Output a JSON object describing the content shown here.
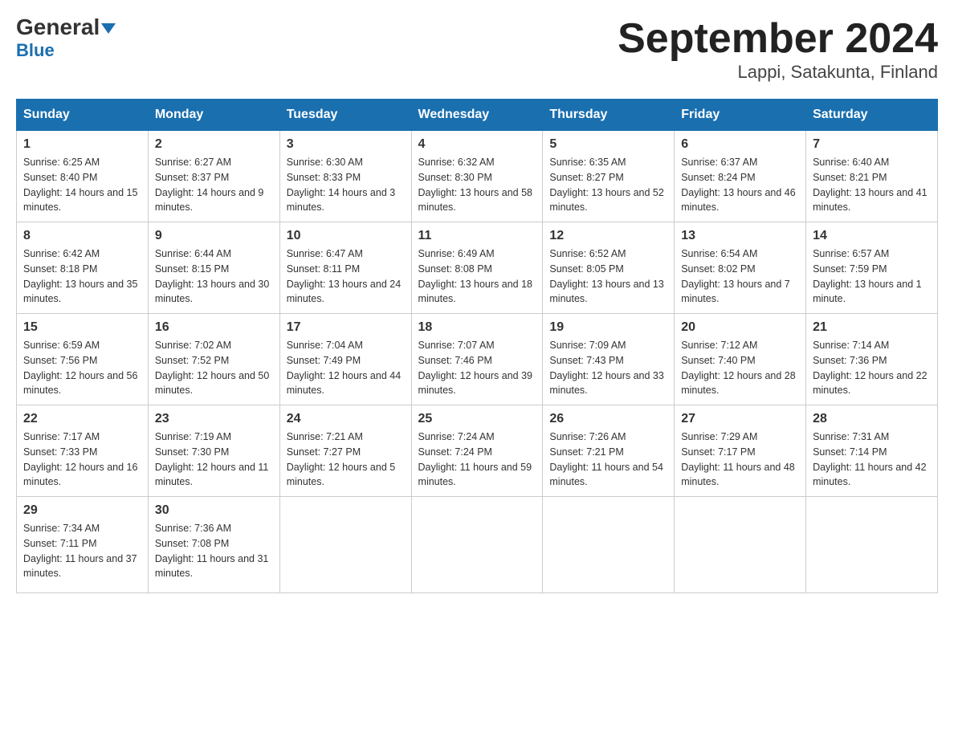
{
  "header": {
    "logo_general": "General",
    "logo_blue": "Blue",
    "month_title": "September 2024",
    "subtitle": "Lappi, Satakunta, Finland"
  },
  "calendar": {
    "days_of_week": [
      "Sunday",
      "Monday",
      "Tuesday",
      "Wednesday",
      "Thursday",
      "Friday",
      "Saturday"
    ],
    "weeks": [
      [
        {
          "day": "1",
          "sunrise": "6:25 AM",
          "sunset": "8:40 PM",
          "daylight": "14 hours and 15 minutes."
        },
        {
          "day": "2",
          "sunrise": "6:27 AM",
          "sunset": "8:37 PM",
          "daylight": "14 hours and 9 minutes."
        },
        {
          "day": "3",
          "sunrise": "6:30 AM",
          "sunset": "8:33 PM",
          "daylight": "14 hours and 3 minutes."
        },
        {
          "day": "4",
          "sunrise": "6:32 AM",
          "sunset": "8:30 PM",
          "daylight": "13 hours and 58 minutes."
        },
        {
          "day": "5",
          "sunrise": "6:35 AM",
          "sunset": "8:27 PM",
          "daylight": "13 hours and 52 minutes."
        },
        {
          "day": "6",
          "sunrise": "6:37 AM",
          "sunset": "8:24 PM",
          "daylight": "13 hours and 46 minutes."
        },
        {
          "day": "7",
          "sunrise": "6:40 AM",
          "sunset": "8:21 PM",
          "daylight": "13 hours and 41 minutes."
        }
      ],
      [
        {
          "day": "8",
          "sunrise": "6:42 AM",
          "sunset": "8:18 PM",
          "daylight": "13 hours and 35 minutes."
        },
        {
          "day": "9",
          "sunrise": "6:44 AM",
          "sunset": "8:15 PM",
          "daylight": "13 hours and 30 minutes."
        },
        {
          "day": "10",
          "sunrise": "6:47 AM",
          "sunset": "8:11 PM",
          "daylight": "13 hours and 24 minutes."
        },
        {
          "day": "11",
          "sunrise": "6:49 AM",
          "sunset": "8:08 PM",
          "daylight": "13 hours and 18 minutes."
        },
        {
          "day": "12",
          "sunrise": "6:52 AM",
          "sunset": "8:05 PM",
          "daylight": "13 hours and 13 minutes."
        },
        {
          "day": "13",
          "sunrise": "6:54 AM",
          "sunset": "8:02 PM",
          "daylight": "13 hours and 7 minutes."
        },
        {
          "day": "14",
          "sunrise": "6:57 AM",
          "sunset": "7:59 PM",
          "daylight": "13 hours and 1 minute."
        }
      ],
      [
        {
          "day": "15",
          "sunrise": "6:59 AM",
          "sunset": "7:56 PM",
          "daylight": "12 hours and 56 minutes."
        },
        {
          "day": "16",
          "sunrise": "7:02 AM",
          "sunset": "7:52 PM",
          "daylight": "12 hours and 50 minutes."
        },
        {
          "day": "17",
          "sunrise": "7:04 AM",
          "sunset": "7:49 PM",
          "daylight": "12 hours and 44 minutes."
        },
        {
          "day": "18",
          "sunrise": "7:07 AM",
          "sunset": "7:46 PM",
          "daylight": "12 hours and 39 minutes."
        },
        {
          "day": "19",
          "sunrise": "7:09 AM",
          "sunset": "7:43 PM",
          "daylight": "12 hours and 33 minutes."
        },
        {
          "day": "20",
          "sunrise": "7:12 AM",
          "sunset": "7:40 PM",
          "daylight": "12 hours and 28 minutes."
        },
        {
          "day": "21",
          "sunrise": "7:14 AM",
          "sunset": "7:36 PM",
          "daylight": "12 hours and 22 minutes."
        }
      ],
      [
        {
          "day": "22",
          "sunrise": "7:17 AM",
          "sunset": "7:33 PM",
          "daylight": "12 hours and 16 minutes."
        },
        {
          "day": "23",
          "sunrise": "7:19 AM",
          "sunset": "7:30 PM",
          "daylight": "12 hours and 11 minutes."
        },
        {
          "day": "24",
          "sunrise": "7:21 AM",
          "sunset": "7:27 PM",
          "daylight": "12 hours and 5 minutes."
        },
        {
          "day": "25",
          "sunrise": "7:24 AM",
          "sunset": "7:24 PM",
          "daylight": "11 hours and 59 minutes."
        },
        {
          "day": "26",
          "sunrise": "7:26 AM",
          "sunset": "7:21 PM",
          "daylight": "11 hours and 54 minutes."
        },
        {
          "day": "27",
          "sunrise": "7:29 AM",
          "sunset": "7:17 PM",
          "daylight": "11 hours and 48 minutes."
        },
        {
          "day": "28",
          "sunrise": "7:31 AM",
          "sunset": "7:14 PM",
          "daylight": "11 hours and 42 minutes."
        }
      ],
      [
        {
          "day": "29",
          "sunrise": "7:34 AM",
          "sunset": "7:11 PM",
          "daylight": "11 hours and 37 minutes."
        },
        {
          "day": "30",
          "sunrise": "7:36 AM",
          "sunset": "7:08 PM",
          "daylight": "11 hours and 31 minutes."
        },
        null,
        null,
        null,
        null,
        null
      ]
    ],
    "sunrise_label": "Sunrise:",
    "sunset_label": "Sunset:",
    "daylight_label": "Daylight:"
  }
}
